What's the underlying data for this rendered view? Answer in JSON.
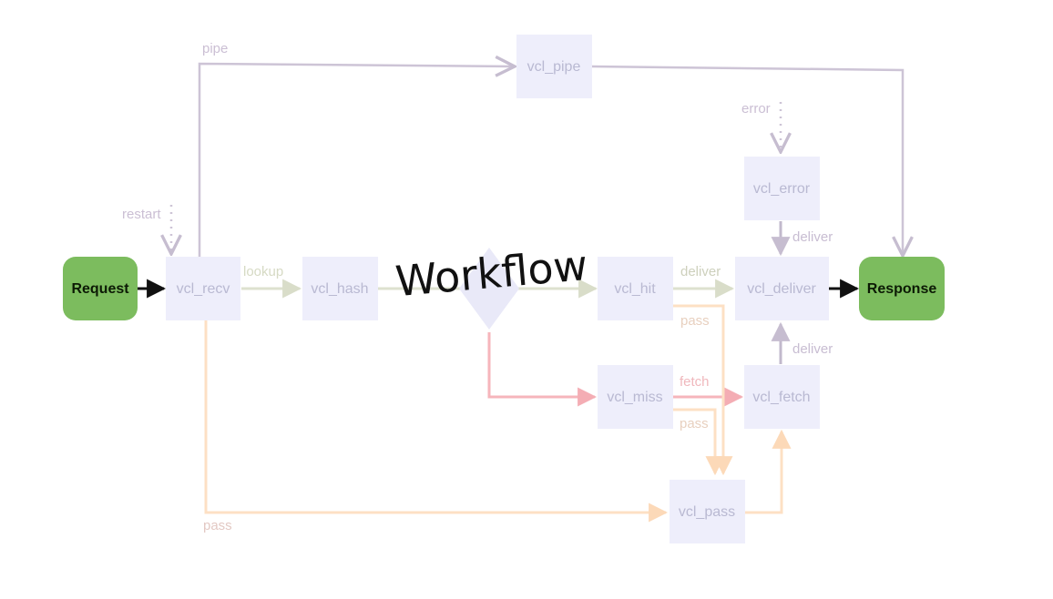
{
  "title": "Workflow",
  "terminals": {
    "request": "Request",
    "response": "Response"
  },
  "nodes": {
    "vcl_recv": "vcl_recv",
    "vcl_hash": "vcl_hash",
    "vcl_pipe": "vcl_pipe",
    "vcl_hit": "vcl_hit",
    "vcl_miss": "vcl_miss",
    "vcl_pass": "vcl_pass",
    "vcl_fetch": "vcl_fetch",
    "vcl_deliver": "vcl_deliver",
    "vcl_error": "vcl_error"
  },
  "edge_labels": {
    "pipe": "pipe",
    "restart": "restart",
    "lookup": "lookup",
    "error": "error",
    "deliver_error": "deliver",
    "deliver_hit": "deliver",
    "deliver_fetch": "deliver",
    "pass_hit": "pass",
    "fetch": "fetch",
    "pass_miss": "pass",
    "pass_recv": "pass"
  },
  "colors": {
    "terminal_fill": "#7cbc5e",
    "node_fill": "#eeeefb",
    "decision_fill": "#e9e9f8",
    "edge_gray": "#cdc4d6",
    "edge_green": "#dde1cf",
    "edge_red": "#f6b5bb",
    "edge_orange": "#fde0c4",
    "edge_black": "#111111"
  }
}
